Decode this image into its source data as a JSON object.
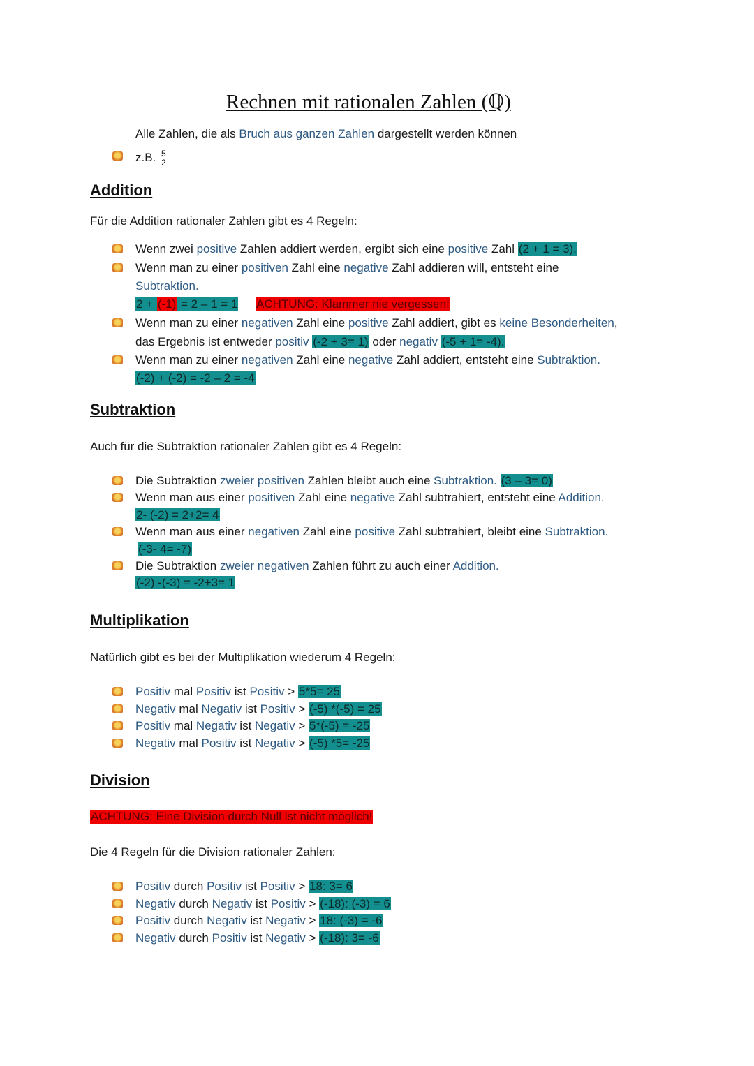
{
  "title": "Rechnen mit rationalen Zahlen (ℚ)",
  "intro": {
    "pre": "Alle Zahlen, die als ",
    "blue": "Bruch aus ganzen Zahlen",
    "post": " dargestellt werden können",
    "example_label": "z.B.",
    "example_num": "5",
    "example_den": "2"
  },
  "addition": {
    "heading": "Addition",
    "intro": "Für die Addition rationaler Zahlen gibt es 4 Regeln:",
    "r1": {
      "a": "Wenn zwei ",
      "b1": "positive",
      "c": " Zahlen addiert werden, ergibt sich eine ",
      "b2": "positive",
      "d": " Zahl ",
      "hl": "(2 + 1 = 3)."
    },
    "r2": {
      "a": "Wenn man zu einer ",
      "b1": "positiven",
      "c": " Zahl eine ",
      "b2": "negative",
      "d": " Zahl addieren will, entsteht eine",
      "b3": "Subtraktion.",
      "ex1": "2 + ",
      "ex_red": "(-1)",
      "ex2": " = 2 – 1 = 1",
      "warn": "ACHTUNG: Klammer nie vergessen!"
    },
    "r3": {
      "a": "Wenn man zu einer ",
      "b1": "negativen",
      "c": " Zahl eine ",
      "b2": "positive",
      "d": " Zahl addiert, gibt es ",
      "b3": "keine Besonderheiten",
      ",": ",",
      "l2a": "das Ergebnis ist entweder ",
      "b4": "positiv",
      "hl1": "(-2 + 3= 1)",
      "l2b": " oder ",
      "b5": "negativ",
      "hl2": "(-5 + 1= -4)."
    },
    "r4": {
      "a": "Wenn man zu einer ",
      "b1": "negativen",
      "c": " Zahl eine ",
      "b2": "negative",
      "d": " Zahl addiert, entsteht eine ",
      "b3": "Subtraktion.",
      "hl": "(-2) + (-2) = -2 – 2 = -4"
    }
  },
  "subtraktion": {
    "heading": "Subtraktion",
    "intro": "Auch für die Subtraktion rationaler Zahlen gibt es 4 Regeln:",
    "r1": {
      "a": "Die Subtraktion ",
      "b1": "zweier positiven",
      "c": " Zahlen bleibt auch eine ",
      "b2": "Subtraktion.",
      "hl": "(3 – 3= 0)"
    },
    "r2": {
      "a": "Wenn man aus einer ",
      "b1": "positiven",
      "c": " Zahl eine ",
      "b2": "negative",
      "d": " Zahl subtrahiert, entsteht eine ",
      "b3": "Addition.",
      "hl": "2- (-2) = 2+2= 4"
    },
    "r3": {
      "a": "Wenn man aus einer ",
      "b1": "negativen",
      "c": " Zahl eine ",
      "b2": "positive",
      "d": " Zahl subtrahiert, bleibt eine ",
      "b3": "Subtraktion.",
      "hl": "(-3- 4= -7)"
    },
    "r4": {
      "a": "Die Subtraktion ",
      "b1": "zweier negativen",
      "c": " Zahlen führt zu auch einer ",
      "b2": "Addition.",
      "hl": "(-2) -(-3) = -2+3= 1"
    }
  },
  "multiplikation": {
    "heading": "Multiplikation",
    "intro": "Natürlich gibt es bei der Multiplikation wiederum 4 Regeln:",
    "rules": [
      {
        "x": "Positiv",
        "op": " mal ",
        "y": "Positiv",
        "ist": " ist ",
        "z": "Positiv",
        "gt": " > ",
        "hl": "5*5= 25"
      },
      {
        "x": "Negativ",
        "op": " mal ",
        "y": "Negativ",
        "ist": " ist ",
        "z": "Positiv",
        "gt": " > ",
        "hl": "(-5) *(-5) = 25"
      },
      {
        "x": "Positiv",
        "op": " mal ",
        "y": "Negativ",
        "ist": " ist ",
        "z": "Negativ",
        "gt": " > ",
        "hl": "5*(-5) = -25"
      },
      {
        "x": "Negativ",
        "op": " mal ",
        "y": "Positiv",
        "ist": " ist ",
        "z": "Negativ",
        "gt": " > ",
        "hl": "(-5) *5= -25"
      }
    ]
  },
  "division": {
    "heading": "Division",
    "warn": "ACHTUNG: Eine Division durch Null ist nicht möglich!",
    "intro": "Die 4 Regeln für die Division rationaler Zahlen:",
    "rules": [
      {
        "x": "Positiv",
        "op": " durch ",
        "y": "Positiv",
        "ist": " ist ",
        "z": "Positiv",
        "gt": " > ",
        "hl": "18: 3= 6"
      },
      {
        "x": "Negativ",
        "op": " durch ",
        "y": "Negativ",
        "ist": " ist ",
        "z": "Positiv",
        "gt": " > ",
        "hl": "(-18): (-3) = 6"
      },
      {
        "x": "Positiv",
        "op": " durch ",
        "y": "Negativ",
        "ist": " ist ",
        "z": "Negativ",
        "gt": " > ",
        "hl": "18: (-3) = -6"
      },
      {
        "x": "Negativ",
        "op": " durch ",
        "y": "Positiv",
        "ist": " ist ",
        "z": "Negativ",
        "gt": " > ",
        "hl": "(-18): 3= -6"
      }
    ]
  },
  "colors": {
    "highlight": "#148f8f",
    "warning": "#f00000",
    "keyword": "#2e5a82"
  }
}
